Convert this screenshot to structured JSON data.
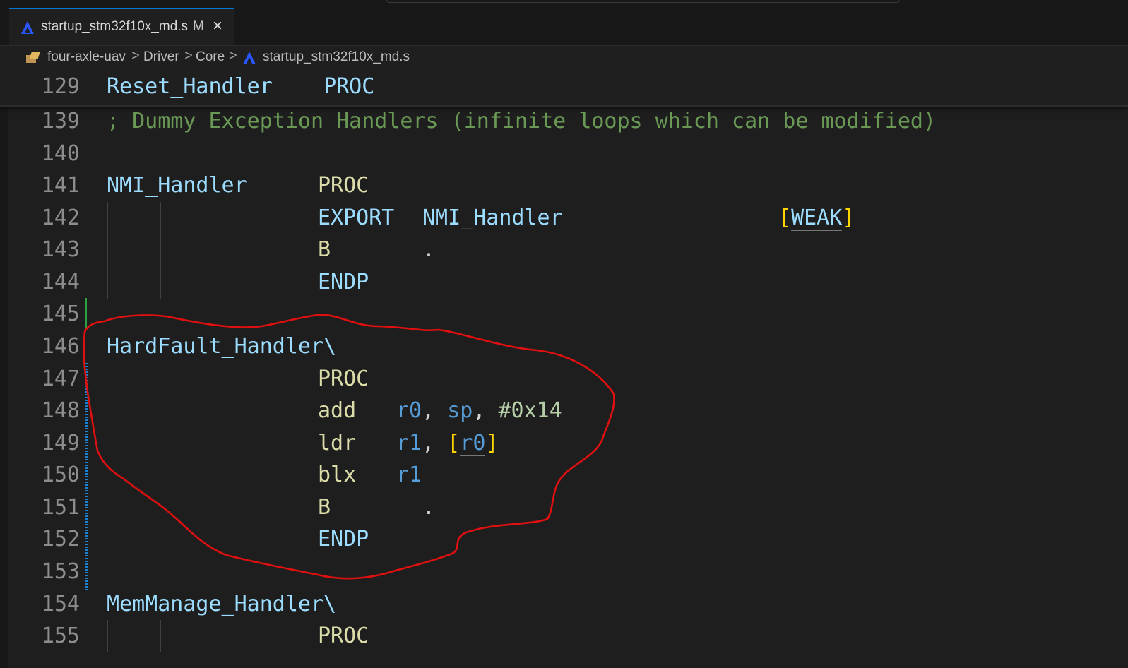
{
  "tab": {
    "file_name": "startup_stm32f10x_md.s",
    "modified_badge": "M",
    "close_glyph": "×",
    "icon": "assembly-file-icon"
  },
  "breadcrumb": {
    "items": [
      "four-axle-uav",
      "Driver",
      "Core",
      "startup_stm32f10x_md.s"
    ],
    "separator": ">",
    "folder_icon": "folder-icon",
    "file_icon": "assembly-file-icon"
  },
  "sticky": {
    "line_number": "129",
    "label": "Reset_Handler",
    "directive": "PROC"
  },
  "lines": [
    {
      "n": "139",
      "comment": "; Dummy Exception Handlers (infinite loops which can be modified)"
    },
    {
      "n": "140"
    },
    {
      "n": "141",
      "label": "NMI_Handler",
      "op": "PROC"
    },
    {
      "n": "142",
      "op": "EXPORT",
      "arg": "NMI_Handler",
      "open": "[",
      "attr": "WEAK",
      "close": "]"
    },
    {
      "n": "143",
      "op": "B",
      "arg": "."
    },
    {
      "n": "144",
      "op": "ENDP"
    },
    {
      "n": "145"
    },
    {
      "n": "146",
      "label": "HardFault_Handler\\"
    },
    {
      "n": "147",
      "op": "PROC"
    },
    {
      "n": "148",
      "op": "add",
      "r1": "r0",
      "c1": ",",
      "r2": "sp",
      "c2": ",",
      "imm": "#0x14"
    },
    {
      "n": "149",
      "op": "ldr",
      "r1": "r1",
      "c1": ",",
      "open": "[",
      "r2": "r0",
      "close": "]"
    },
    {
      "n": "150",
      "op": "blx",
      "r1": "r1"
    },
    {
      "n": "151",
      "op": "B",
      "arg": "."
    },
    {
      "n": "152",
      "op": "ENDP"
    },
    {
      "n": "153"
    },
    {
      "n": "154",
      "label": "MemManage_Handler\\"
    },
    {
      "n": "155",
      "op": "PROC"
    }
  ],
  "colors": {
    "background": "#1e1e1e",
    "label": "#9cdcfe",
    "mnemonic": "#dcdcaa",
    "register": "#569cd6",
    "immediate": "#b5cea8",
    "comment": "#6a9955",
    "bracket": "#ffd700",
    "annotation": "#e01010",
    "modified_gutter": "#1b81d1",
    "added_gutter": "#2ea043"
  }
}
